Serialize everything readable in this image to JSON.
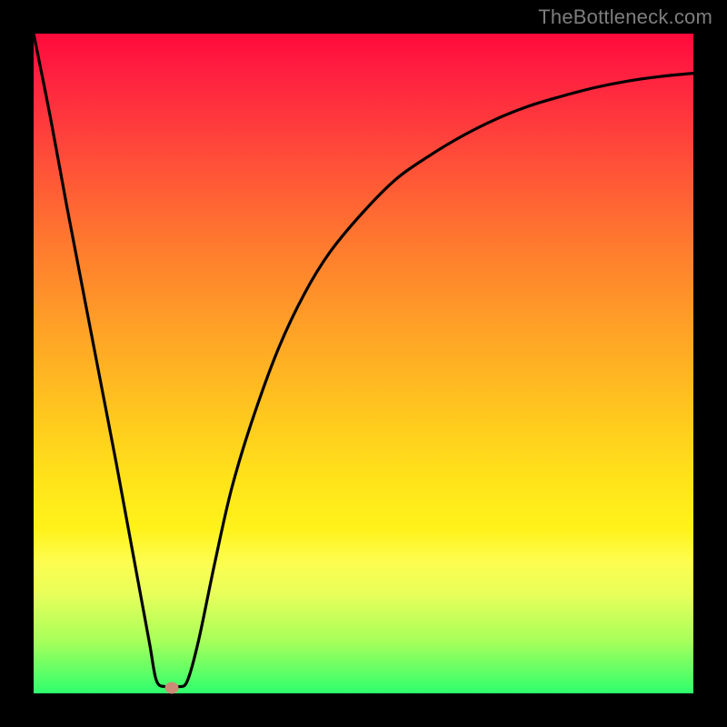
{
  "watermark": "TheBottleneck.com",
  "chart_data": {
    "type": "line",
    "title": "",
    "xlabel": "",
    "ylabel": "",
    "xlim": [
      0,
      1
    ],
    "ylim": [
      0,
      1
    ],
    "x": [
      0.0,
      0.025,
      0.05,
      0.075,
      0.1,
      0.125,
      0.15,
      0.175,
      0.186,
      0.2,
      0.22,
      0.233,
      0.25,
      0.275,
      0.3,
      0.33,
      0.37,
      0.41,
      0.45,
      0.5,
      0.55,
      0.6,
      0.65,
      0.7,
      0.75,
      0.8,
      0.85,
      0.9,
      0.95,
      1.0
    ],
    "y": [
      1.0,
      0.875,
      0.74,
      0.61,
      0.48,
      0.35,
      0.215,
      0.08,
      0.02,
      0.01,
      0.01,
      0.019,
      0.08,
      0.2,
      0.31,
      0.41,
      0.52,
      0.605,
      0.67,
      0.73,
      0.78,
      0.815,
      0.845,
      0.87,
      0.89,
      0.905,
      0.918,
      0.928,
      0.935,
      0.94
    ],
    "marker": {
      "x": 0.21,
      "y": 0.008
    },
    "gradient_stops": [
      {
        "pos": 0.0,
        "color": "#ff0a3c"
      },
      {
        "pos": 0.5,
        "color": "#ffc81e"
      },
      {
        "pos": 0.78,
        "color": "#fff21a"
      },
      {
        "pos": 1.0,
        "color": "#2eff6e"
      }
    ]
  }
}
